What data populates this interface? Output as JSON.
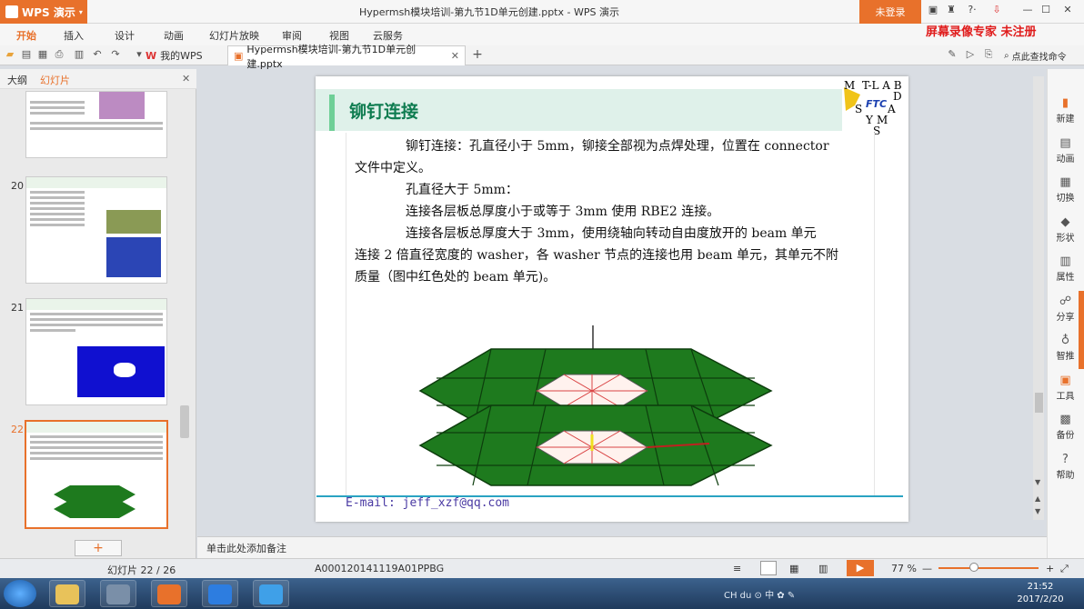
{
  "app": {
    "name": "WPS 演示",
    "window_title": "Hypermsh模块培训-第九节1D单元创建.pptx - WPS 演示",
    "login_label": "未登录",
    "window_controls": [
      "skin-icon",
      "shirt-icon",
      "help-icon",
      "minimize-icon",
      "maximize-icon",
      "close-icon"
    ],
    "help_label": "?·"
  },
  "menu": [
    "开始",
    "插入",
    "设计",
    "动画",
    "幻灯片放映",
    "审阅",
    "视图",
    "云服务"
  ],
  "watermark": "屏幕录像专家 未注册",
  "tabs": {
    "home": "我的WPS",
    "doc": "Hypermsh模块培训-第九节1D单元创建.pptx"
  },
  "search_placeholder": "点此查找命令",
  "left_panel": {
    "tabs": [
      "大纲",
      "幻灯片"
    ],
    "slides": [
      {
        "num": "20"
      },
      {
        "num": "21"
      },
      {
        "num": "22"
      }
    ]
  },
  "slide": {
    "title": "铆钉连接",
    "paragraphs": [
      "铆钉连接：孔直径小于 5mm，铆接全部视为点焊处理，位置在 connector",
      "文件中定义。",
      "孔直径大于 5mm：",
      "连接各层板总厚度小于或等于 3mm 使用 RBE2 连接。",
      "连接各层板总厚度大于 3mm，使用绕轴向转动自由度放开的 beam 单元",
      "连接 2 倍直径宽度的 washer，各 washer 节点的连接也用 beam 单元，其单元不附",
      "质量（图中红色处的 beam 单元)。"
    ],
    "email": "E-mail: jeff_xzf@qq.com",
    "logo": {
      "letters": [
        "M",
        "T",
        "L",
        "A",
        "B",
        "FTC",
        "D",
        "S",
        "A",
        "Y",
        "M",
        "S"
      ]
    }
  },
  "right_panel": [
    {
      "label": "新建"
    },
    {
      "label": "动画"
    },
    {
      "label": "切换"
    },
    {
      "label": "形状"
    },
    {
      "label": "属性"
    },
    {
      "label": "分享"
    },
    {
      "label": "智推"
    },
    {
      "label": "工具"
    },
    {
      "label": "备份"
    },
    {
      "label": "帮助"
    }
  ],
  "notes_placeholder": "单击此处添加备注",
  "status": {
    "slide_count": "幻灯片 22 / 26",
    "doc_id": "A000120141119A01PPBG",
    "zoom": "77 %",
    "zoom_fraction": 0.35
  },
  "taskbar": {
    "time": "21:52",
    "date": "2017/2/20",
    "tray": "CH  du  ⊙  中  ✿  ✎"
  },
  "colors": {
    "accent": "#e8712b",
    "slide_title": "#0e7c50",
    "plate_green": "#1e7a1e"
  }
}
